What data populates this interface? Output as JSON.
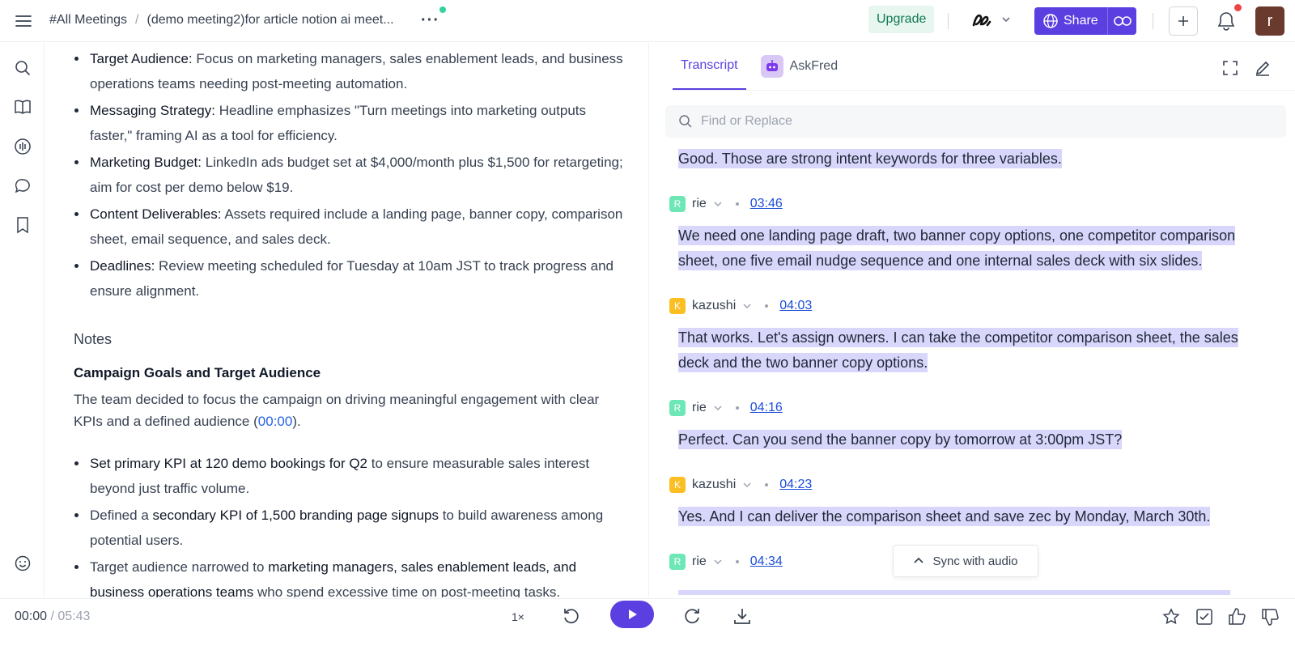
{
  "header": {
    "breadcrumb_root": "#All Meetings",
    "breadcrumb_sep": "/",
    "meeting_title": "(demo meeting2)for article notion ai meet...",
    "more_label": "···",
    "upgrade_label": "Upgrade",
    "share_label": "Share",
    "avatar_initial": "r"
  },
  "notes": {
    "bullets_top": [
      {
        "bold": "Target Audience:",
        "text": " Focus on marketing managers, sales enablement leads, and business operations teams needing post-meeting automation."
      },
      {
        "bold": "Messaging Strategy:",
        "text": " Headline emphasizes \"Turn meetings into marketing outputs faster,\" framing AI as a tool for efficiency."
      },
      {
        "bold": "Marketing Budget:",
        "text": " LinkedIn ads budget set at $4,000/month plus $1,500 for retargeting; aim for cost per demo below $19."
      },
      {
        "bold": "Content Deliverables:",
        "text": " Assets required include a landing page, banner copy, comparison sheet, email sequence, and sales deck."
      },
      {
        "bold": "Deadlines:",
        "text": " Review meeting scheduled for Tuesday at 10am JST to track progress and ensure alignment."
      }
    ],
    "section_heading": "Notes",
    "sub_heading": "Campaign Goals and Target Audience",
    "paragraph_before": "The team decided to focus the campaign on driving meaningful engagement with clear KPIs and a defined audience (",
    "paragraph_timestamp": "00:00",
    "paragraph_after": ").",
    "bullets_bottom": [
      {
        "pre": "",
        "bold": "Set primary KPI at 120 demo bookings for Q2",
        "post": " to ensure measurable sales interest beyond just traffic volume."
      },
      {
        "pre": "Defined a ",
        "bold": "secondary KPI of 1,500 branding page signups",
        "post": " to build awareness among potential users."
      },
      {
        "pre": "Target audience narrowed to ",
        "bold": "marketing managers, sales enablement leads, and business operations teams",
        "post": " who spend excessive time on post-meeting tasks."
      }
    ]
  },
  "transcript": {
    "tab_transcript": "Transcript",
    "tab_askfred": "AskFred",
    "search_placeholder": "Find or Replace",
    "first_line": "Good. Those are strong intent keywords for three variables.",
    "entries": [
      {
        "initial": "R",
        "speaker": "rie",
        "time": "03:46",
        "lines": [
          "We need one landing page draft, two banner copy options, one competitor comparison",
          "sheet, one five email nudge sequence and one internal sales deck with six slides."
        ]
      },
      {
        "initial": "K",
        "speaker": "kazushi",
        "time": "04:03",
        "lines": [
          "That works. Let's assign owners. I can take the competitor comparison sheet, the sales",
          "deck and the two banner copy options."
        ]
      },
      {
        "initial": "R",
        "speaker": "rie",
        "time": "04:16",
        "lines": [
          "Perfect. Can you send the banner copy by tomorrow at 3:00pm JST?"
        ]
      },
      {
        "initial": "K",
        "speaker": "kazushi",
        "time": "04:23",
        "lines": [
          "Yes. And I can deliver the comparison sheet and save zec by Monday, March 30th."
        ]
      },
      {
        "initial": "R",
        "speaker": "rie",
        "time": "04:34",
        "lines": []
      }
    ],
    "sync_label": "Sync with audio"
  },
  "player": {
    "current_time": "00:00",
    "time_sep": "/",
    "total_time": "05:43",
    "speed": "1×"
  },
  "colors": {
    "accent": "#5b3fe0",
    "highlight": "#d9d6fb",
    "upgrade_bg": "#e7f6ef",
    "speaker_r": "#6ee7b7",
    "speaker_k": "#fbbf24"
  },
  "icons": [
    "hamburger-icon",
    "search-icon",
    "book-icon",
    "audio-icon",
    "chat-icon",
    "bookmark-icon",
    "smiley-icon",
    "globe-icon",
    "link-icon",
    "plus-icon",
    "bell-icon",
    "expand-icon",
    "edit-icon",
    "chevron-down-icon",
    "chevron-up-icon",
    "rewind-icon",
    "play-icon",
    "forward-icon",
    "download-icon",
    "star-icon",
    "checkbox-icon",
    "thumbs-up-icon",
    "thumbs-down-icon"
  ]
}
